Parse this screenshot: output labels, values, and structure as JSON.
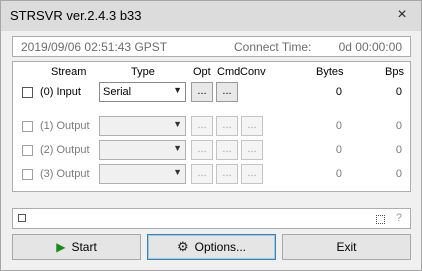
{
  "window": {
    "title": "STRSVR ver.2.4.3 b33",
    "close_glyph": "×"
  },
  "timebar": {
    "timestamp": "2019/09/06 02:51:43 GPST",
    "connect_label": "Connect Time:",
    "connect_value": "0d 00:00:00"
  },
  "headers": {
    "stream": "Stream",
    "type": "Type",
    "opt": "Opt",
    "cmd": "Cmd",
    "conv": "Conv",
    "bytes": "Bytes",
    "bps": "Bps"
  },
  "rows": [
    {
      "label": "(0) Input",
      "type": "Serial",
      "opt": "...",
      "cmd": "...",
      "bytes": "0",
      "bps": "0",
      "enabled": true
    },
    {
      "label": "(1) Output",
      "type": "",
      "opt": "...",
      "cmd": "...",
      "conv": "...",
      "bytes": "0",
      "bps": "0",
      "enabled": false
    },
    {
      "label": "(2) Output",
      "type": "",
      "opt": "...",
      "cmd": "...",
      "conv": "...",
      "bytes": "0",
      "bps": "0",
      "enabled": false
    },
    {
      "label": "(3) Output",
      "type": "",
      "opt": "...",
      "cmd": "...",
      "conv": "...",
      "bytes": "0",
      "bps": "0",
      "enabled": false
    }
  ],
  "message_bar": {
    "help_glyph": "?"
  },
  "buttons": {
    "start": "Start",
    "options": "Options...",
    "exit": "Exit"
  },
  "icons": {
    "start": "play-icon",
    "options": "gear-icon"
  }
}
